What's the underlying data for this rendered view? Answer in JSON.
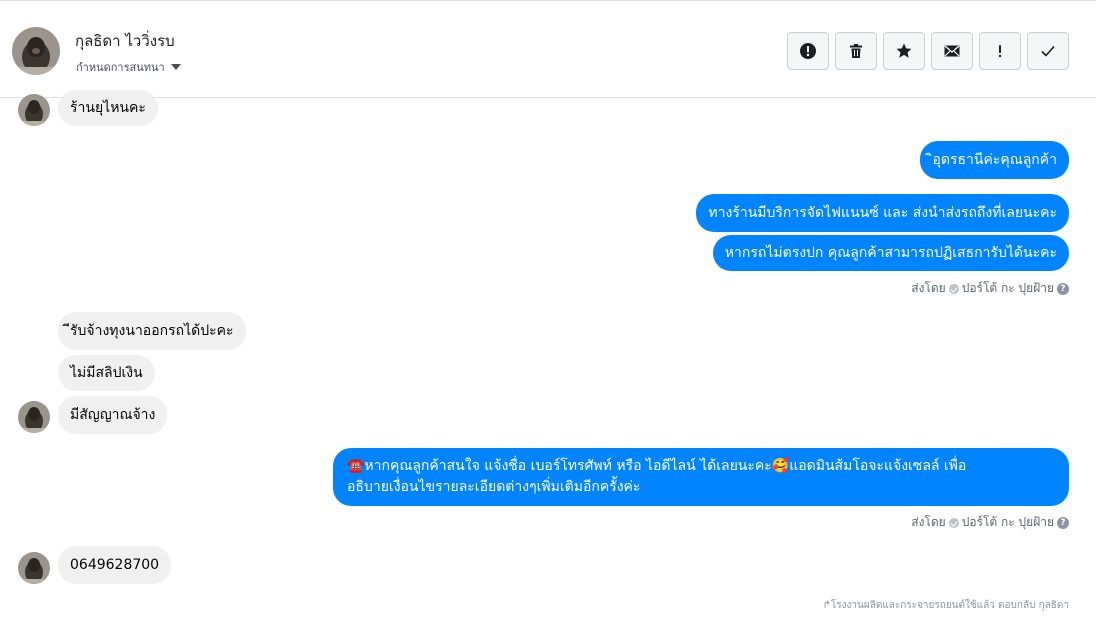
{
  "header": {
    "contact_name": "กุลธิดา ไววิ่งรบ",
    "assign_label": "กำหนดการสนทนา",
    "actions": [
      {
        "name": "mark-spam-button",
        "icon": "exclamation-circle-icon"
      },
      {
        "name": "delete-button",
        "icon": "trash-icon"
      },
      {
        "name": "star-button",
        "icon": "star-icon"
      },
      {
        "name": "mark-unread-button",
        "icon": "envelope-icon"
      },
      {
        "name": "follow-up-button",
        "icon": "exclamation-icon"
      },
      {
        "name": "mark-done-button",
        "icon": "checkmark-icon"
      }
    ]
  },
  "messages": {
    "m1": "ร้านยุไหนคะ",
    "m2": "ิอุดรธานีค่ะคุณลูกค้า",
    "m3": "ทางร้านมีบริการจัดไฟแนนซ์ และ ส่งนำส่งรถถึงที่เลยนะคะ",
    "m4": "หากรถไม่ตรงปก คุณลูกค้าสามารถปฏิเสธการับได้นะคะ",
    "m5": "ีรับจ้างทุงนาออกรถได้ปะคะ",
    "m6": "ไม่มีสลิปเงิน",
    "m7": "มีสัญญาณจ้าง",
    "m8_line1": "☎️หากคุณลูกค้าสนใจ แจ้งชื่อ เบอร์โทรศัพท์ หรือ ไอดีไลน์  ได้เลยนะคะ🥰แอดมินส้มโอจะแจ้งเซลล์   เพื่อ",
    "m8_line2": "อธิบายเงื่อนไขรายละเอียดต่างๆเพิ่มเติมอีกครั้งค่ะ",
    "m9": "0649628700"
  },
  "sent_by": {
    "prefix": "ส่งโดย",
    "name": "ปอร์โต้ กะ ปุยฝ้าย",
    "help": "?"
  },
  "footer_note": "↱โรงงานผลิตและกระจายรถยนต์ใช้แล้ว ตอบกลับ กุลธิดา",
  "colors": {
    "outgoing_bubble": "#0084ff",
    "incoming_bubble": "#f0f0f0"
  }
}
